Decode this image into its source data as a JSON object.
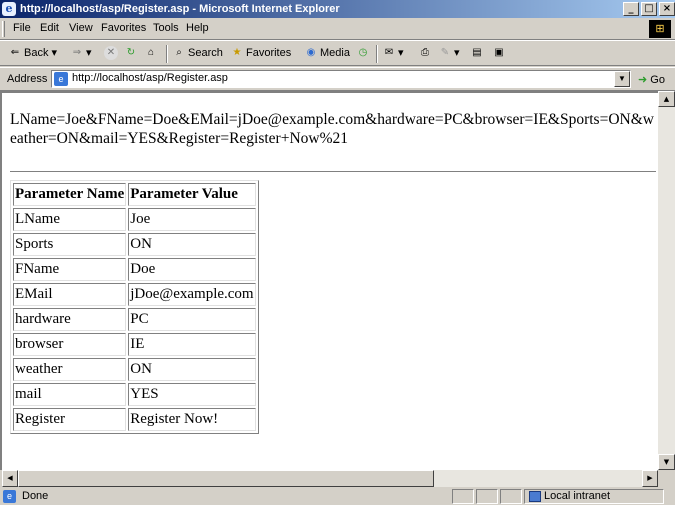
{
  "window": {
    "title": "http://localhost/asp/Register.asp - Microsoft Internet Explorer"
  },
  "menu": [
    "File",
    "Edit",
    "View",
    "Favorites",
    "Tools",
    "Help"
  ],
  "toolbar": {
    "back": "Back",
    "search": "Search",
    "favorites": "Favorites",
    "media": "Media"
  },
  "address": {
    "label": "Address",
    "url": "http://localhost/asp/Register.asp",
    "go": "Go"
  },
  "page": {
    "query_string": "LName=Joe&FName=Doe&EMail=jDoe@example.com&hardware=PC&browser=IE&Sports=ON&weather=ON&mail=YES&Register=Register+Now%21",
    "table": {
      "headers": [
        "Parameter Name",
        "Parameter Value"
      ],
      "rows": [
        [
          "LName",
          "Joe"
        ],
        [
          "Sports",
          "ON"
        ],
        [
          "FName",
          "Doe"
        ],
        [
          "EMail",
          "jDoe@example.com"
        ],
        [
          "hardware",
          "PC"
        ],
        [
          "browser",
          "IE"
        ],
        [
          "weather",
          "ON"
        ],
        [
          "mail",
          "YES"
        ],
        [
          "Register",
          "Register Now!"
        ]
      ]
    }
  },
  "status": {
    "text": "Done",
    "zone": "Local intranet"
  }
}
